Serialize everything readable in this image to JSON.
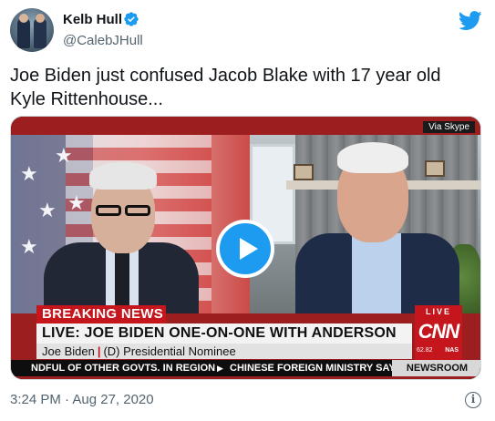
{
  "tweet": {
    "author_name": "Kelb Hull",
    "author_handle": "@CalebJHull",
    "text": "Joe Biden just confused Jacob Blake with 17 year old Kyle Rittenhouse...",
    "timestamp": "3:24 PM · Aug 27, 2020",
    "verified": true
  },
  "icons": {
    "verified": "verified-badge-icon",
    "brand": "twitter-bird-icon",
    "play": "play-icon",
    "info": "info-icon"
  },
  "video": {
    "via_label": "Via Skype",
    "breaking_label": "BREAKING NEWS",
    "headline": "LIVE: JOE BIDEN ONE-ON-ONE WITH ANDERSON",
    "subtitle_name": "Joe Biden",
    "subtitle_separator": "|",
    "subtitle_role": "(D) Presidential Nominee",
    "network_live": "LIVE",
    "network_logo": "CNN",
    "market_value": "62.82",
    "market_label": "NAS",
    "ticker_left": "NDFUL OF OTHER GOVTS. IN REGION",
    "ticker_right": "CHINESE FOREIGN MINISTRY SAYS",
    "newsroom_label": "NEWSROOM",
    "ticker_arrow": "▶"
  },
  "colors": {
    "twitter_blue": "#1d9bf0",
    "cnn_red": "#c4161c",
    "text_primary": "#0f1419",
    "text_secondary": "#536471"
  }
}
